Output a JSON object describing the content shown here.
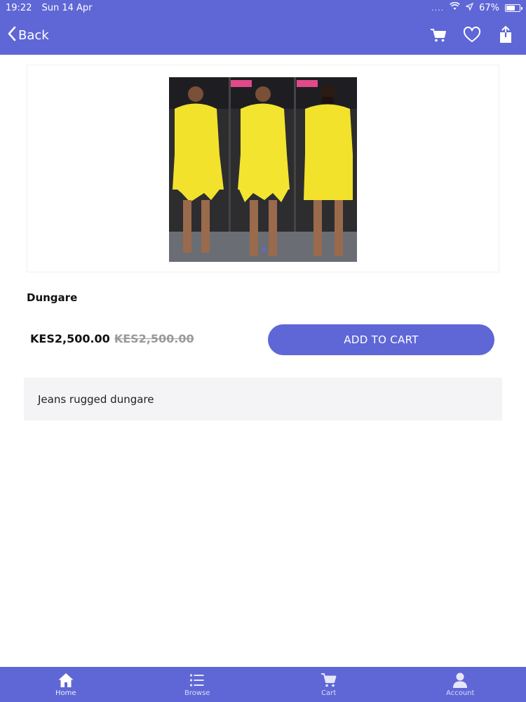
{
  "status_bar": {
    "time": "19:22",
    "date": "Sun 14 Apr",
    "signal": "....",
    "battery": "67%",
    "battery_level": 0.67
  },
  "nav": {
    "back_label": "Back",
    "actions": [
      "cart-icon",
      "heart-icon",
      "share-icon"
    ]
  },
  "product": {
    "title": "Dungare",
    "price": "KES2,500.00",
    "old_price": "KES2,500.00",
    "add_to_cart_label": "ADD TO CART",
    "description": "Jeans rugged dungare"
  },
  "colors": {
    "accent": "#5f67d6",
    "description_bg": "#f4f4f6",
    "old_price": "#9a9a9a"
  },
  "tab_bar": {
    "tabs": [
      {
        "label": "Home",
        "icon": "home-icon",
        "active": true
      },
      {
        "label": "Browse",
        "icon": "list-icon",
        "active": false
      },
      {
        "label": "Cart",
        "icon": "cart-icon",
        "active": false
      },
      {
        "label": "Account",
        "icon": "user-icon",
        "active": false
      }
    ]
  }
}
